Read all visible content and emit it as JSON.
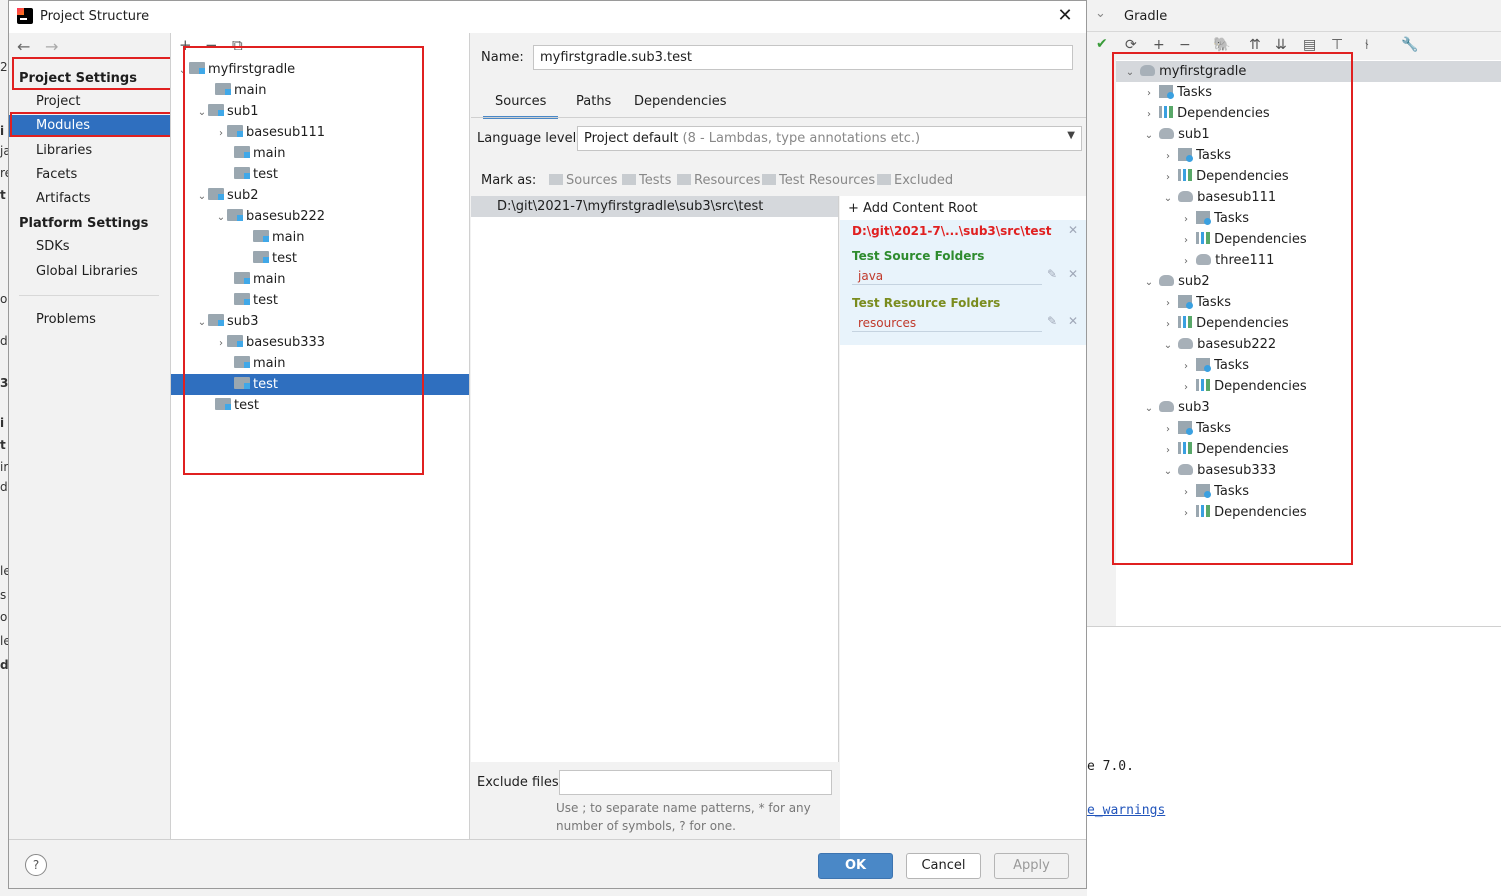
{
  "dialog": {
    "title": "Project Structure",
    "close_label": "✕"
  },
  "left_nav": {
    "project_settings_title": "Project Settings",
    "project_items": [
      {
        "label": "Project"
      },
      {
        "label": "Modules"
      },
      {
        "label": "Libraries"
      },
      {
        "label": "Facets"
      },
      {
        "label": "Artifacts"
      }
    ],
    "platform_settings_title": "Platform Settings",
    "platform_items": [
      {
        "label": "SDKs"
      },
      {
        "label": "Global Libraries"
      }
    ],
    "problems_label": "Problems"
  },
  "module_tree": {
    "nodes": [
      {
        "label": "myfirstgradle"
      },
      {
        "label": "main"
      },
      {
        "label": "sub1"
      },
      {
        "label": "basesub111"
      },
      {
        "label": "main"
      },
      {
        "label": "test"
      },
      {
        "label": "sub2"
      },
      {
        "label": "basesub222"
      },
      {
        "label": "main"
      },
      {
        "label": "test"
      },
      {
        "label": "main"
      },
      {
        "label": "test"
      },
      {
        "label": "sub3"
      },
      {
        "label": "basesub333"
      },
      {
        "label": "main"
      },
      {
        "label": "test"
      },
      {
        "label": "test"
      }
    ]
  },
  "main": {
    "name_label": "Name:",
    "name_value": "myfirstgradle.sub3.test",
    "tabs": [
      {
        "label": "Sources"
      },
      {
        "label": "Paths"
      },
      {
        "label": "Dependencies"
      }
    ],
    "language_level_label": "Language level:",
    "language_level_value": "Project default",
    "language_level_hint": "(8 - Lambdas, type annotations etc.)",
    "mark_as_label": "Mark as:",
    "mark_as_options": [
      {
        "label": "Sources"
      },
      {
        "label": "Tests"
      },
      {
        "label": "Resources"
      },
      {
        "label": "Test Resources"
      },
      {
        "label": "Excluded"
      }
    ],
    "content_root_path": "D:\\git\\2021-7\\myfirstgradle\\sub3\\src\\test",
    "add_content_root_label": "Add Content Root",
    "content_root_short": "D:\\git\\2021-7\\...\\sub3\\src\\test",
    "test_source_folders_title": "Test Source Folders",
    "test_source_folder": "java",
    "test_resource_folders_title": "Test Resource Folders",
    "test_resource_folder": "resources",
    "exclude_files_label": "Exclude files:",
    "exclude_files_value": "",
    "exclude_hint": "Use ; to separate name patterns, * for any number of symbols, ? for one."
  },
  "footer": {
    "help_label": "?",
    "ok_label": "OK",
    "cancel_label": "Cancel",
    "apply_label": "Apply"
  },
  "gradle": {
    "title": "Gradle",
    "tree": [
      {
        "label": "myfirstgradle"
      },
      {
        "label": "Tasks"
      },
      {
        "label": "Dependencies"
      },
      {
        "label": "sub1"
      },
      {
        "label": "Tasks"
      },
      {
        "label": "Dependencies"
      },
      {
        "label": "basesub111"
      },
      {
        "label": "Tasks"
      },
      {
        "label": "Dependencies"
      },
      {
        "label": "three111"
      },
      {
        "label": "sub2"
      },
      {
        "label": "Tasks"
      },
      {
        "label": "Dependencies"
      },
      {
        "label": "basesub222"
      },
      {
        "label": "Tasks"
      },
      {
        "label": "Dependencies"
      },
      {
        "label": "sub3"
      },
      {
        "label": "Tasks"
      },
      {
        "label": "Dependencies"
      },
      {
        "label": "basesub333"
      },
      {
        "label": "Tasks"
      },
      {
        "label": "Dependencies"
      }
    ],
    "console_line1": "e 7.0.",
    "console_link": "e_warnings"
  },
  "background_fragments": [
    "2",
    "i",
    "ja",
    "re",
    "t",
    "o",
    "dl",
    "3",
    "i",
    "t",
    "ir",
    "dl",
    "le",
    "s",
    "o",
    "le",
    "d"
  ],
  "colors": {
    "selection": "#2f6fbf",
    "annotation_red": "#e02020",
    "accent_blue": "#4a88c7"
  }
}
